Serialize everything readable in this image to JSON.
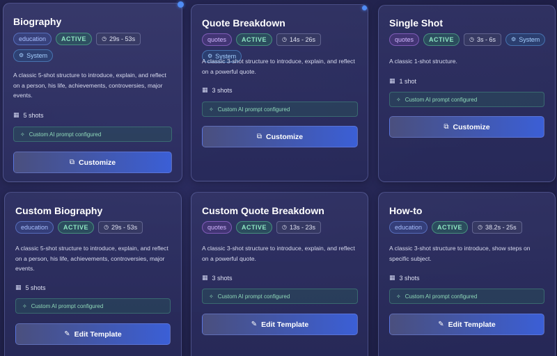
{
  "cards": [
    {
      "title": "Biography",
      "category": "education",
      "status": "ACTIVE",
      "duration": "29s - 53s",
      "system": "System",
      "description": "A classic 5-shot structure to introduce, explain, and reflect on a person, his life, achievements, controversies, major events.",
      "shots": "5 shots",
      "prompt": "Custom AI prompt configured",
      "action": "Customize"
    },
    {
      "title": "Quote Breakdown",
      "category": "quotes",
      "status": "ACTIVE",
      "duration": "14s - 26s",
      "system": "System",
      "description": "A classic 3-shot structure to introduce, explain, and reflect on a powerful quote.",
      "shots": "3 shots",
      "prompt": "Custom AI prompt configured",
      "action": "Customize"
    },
    {
      "title": "Single Shot",
      "category": "quotes",
      "status": "ACTIVE",
      "duration": "3s - 6s",
      "system": "System",
      "description": "A classic 1-shot structure.",
      "shots": "1 shot",
      "prompt": "Custom AI prompt configured",
      "action": "Customize"
    },
    {
      "title": "Custom Biography",
      "category": "education",
      "status": "ACTIVE",
      "duration": "29s - 53s",
      "description": "A classic 5-shot structure to introduce, explain, and reflect on a person, his life, achievements, controversies, major events.",
      "shots": "5 shots",
      "prompt": "Custom AI prompt configured",
      "action": "Edit Template"
    },
    {
      "title": "Custom Quote Breakdown",
      "category": "quotes",
      "status": "ACTIVE",
      "duration": "13s - 23s",
      "description": "A classic 3-shot structure to introduce, explain, and reflect on a powerful quote.",
      "shots": "3 shots",
      "prompt": "Custom AI prompt configured",
      "action": "Edit Template"
    },
    {
      "title": "How-to",
      "category": "education",
      "status": "ACTIVE",
      "duration": "38.2s - 25s",
      "description": "A classic 3-shot structure to introduce, show steps on specific subject.",
      "shots": "3 shots",
      "prompt": "Custom AI prompt configured",
      "action": "Edit Template"
    }
  ],
  "icons": {
    "clock": "clock-icon",
    "gear": "gear-icon",
    "film": "film-icon",
    "sparkle": "sparkle-icon",
    "copy": "copy-icon",
    "pencil": "pencil-icon"
  },
  "colors": {
    "accent": "#3b5fd6",
    "active": "#8ee6c2",
    "background": "#23244f"
  }
}
